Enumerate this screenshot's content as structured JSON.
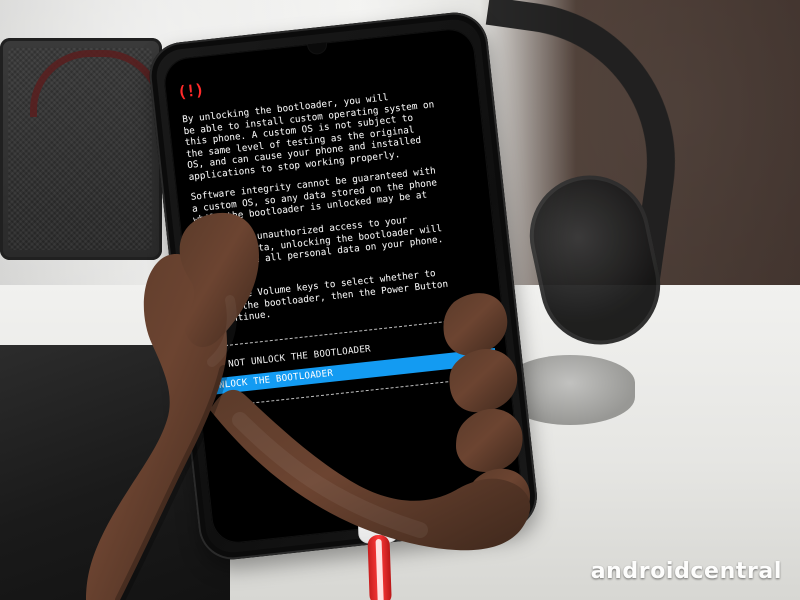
{
  "screen": {
    "warning_icon": "(!)",
    "paragraphs": [
      "By unlocking the bootloader, you will\nbe able to install custom operating system on\nthis phone. A custom OS is not subject to\nthe same level of testing as the original\nOS, and can cause your phone and installed\napplications to stop working properly.",
      "Software integrity cannot be guaranteed with\na custom OS, so any data stored on the phone\nwhile the bootloader is unlocked may be at\nrisk.",
      "To prevent unauthorized access to your\npersonal data, unlocking the bootloader will\nalso delete all personal data on your phone.",
      "Press the Volume keys to select whether to\nunlock the bootloader, then the Power Button\nto continue."
    ],
    "menu": {
      "options": [
        "DO NOT UNLOCK THE BOOTLOADER",
        "UNLOCK THE BOOTLOADER"
      ],
      "selected_index": 1
    }
  },
  "watermark": {
    "text": "androidcentral"
  },
  "colors": {
    "warning_red": "#ff2a2a",
    "selection_blue": "#139bf2",
    "cable_red": "#ff3b3b"
  },
  "icons": {
    "warning": "warning-icon"
  }
}
